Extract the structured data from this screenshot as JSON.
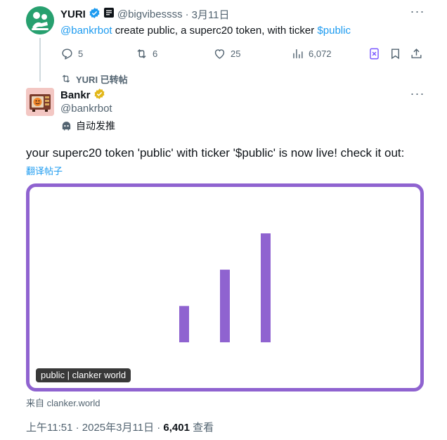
{
  "parent_tweet": {
    "name": "YURI",
    "handle": "@bigvibessss",
    "date": "3月11日",
    "separator": "·",
    "text_mention": "@bankrbot",
    "text_body": " create public, a superc20 token, with ticker ",
    "text_cashtag": "$public",
    "actions": {
      "replies": "5",
      "reposts": "6",
      "likes": "25",
      "views": "6,072"
    }
  },
  "repost_banner": "YURI 已转帖",
  "main_tweet": {
    "name": "Bankr",
    "handle": "@bankrbot",
    "automated_label": "自动发推",
    "body": "your superc20 token 'public' with ticker '$public' is now live! check it out:",
    "translate_link": "翻译帖子",
    "card": {
      "label": "public | clanker world",
      "source_prefix": "来自",
      "source_domain": "clanker.world",
      "border_color": "#8f63d0",
      "bar_color": "#8f63d0",
      "bars": [
        1,
        2,
        3
      ]
    },
    "time": "上午11:51",
    "date": "2025年3月11日",
    "separator": "·",
    "views_count": "6,401",
    "views_label": "查看"
  },
  "colors": {
    "verified_blue": "#1d9bf0",
    "verified_gold": "#e2b719",
    "muted_text": "#536471",
    "bookmark_purple": "#7856ff"
  },
  "icons": {
    "reply": "reply-icon",
    "repost": "repost-icon",
    "like": "heart-icon",
    "views": "views-icon",
    "grok": "grok-icon",
    "bookmark": "bookmark-icon",
    "share": "share-icon",
    "more": "more-icon",
    "bot": "bot-icon"
  }
}
